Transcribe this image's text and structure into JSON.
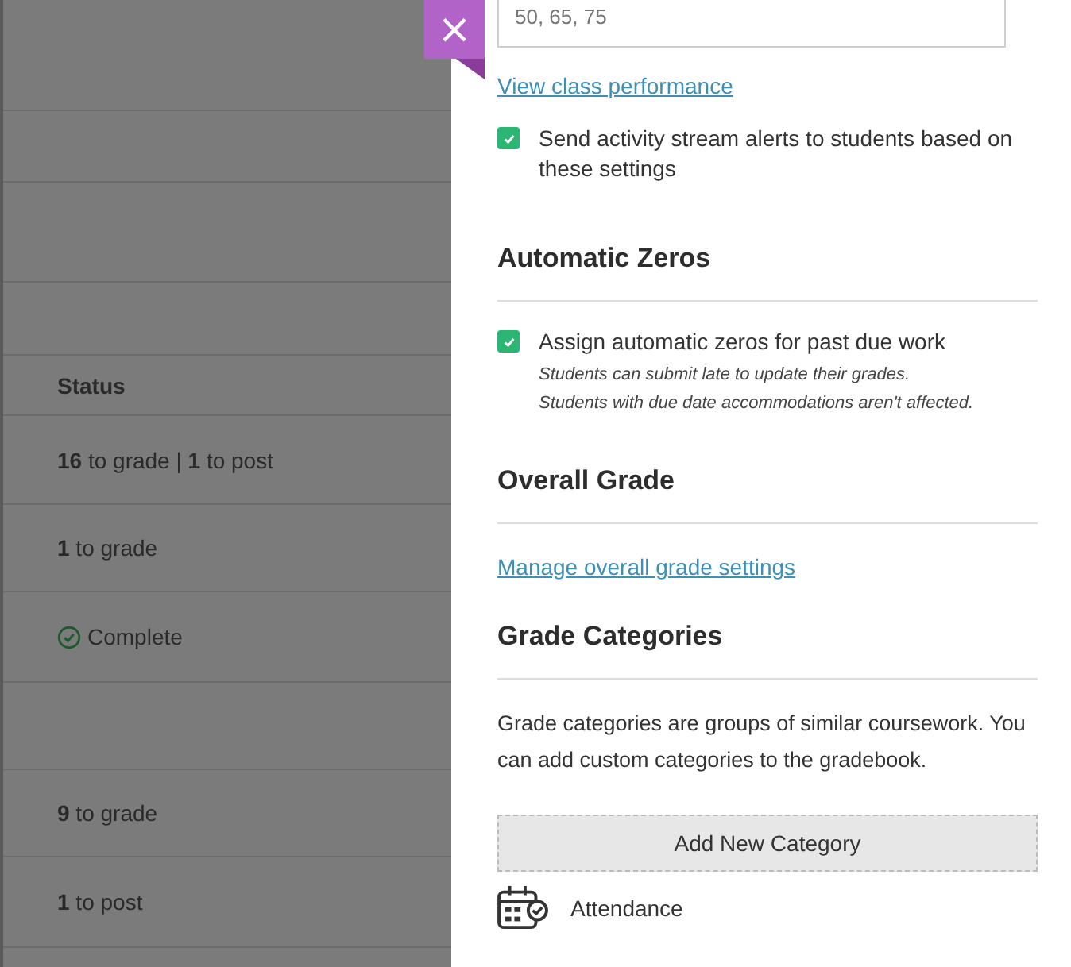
{
  "background_table": {
    "rows": [
      {
        "kind": "empty"
      },
      {
        "kind": "empty"
      },
      {
        "kind": "empty"
      },
      {
        "kind": "empty"
      },
      {
        "kind": "header",
        "text": "Status"
      },
      {
        "kind": "status",
        "text": "**16** to grade | **1** to post"
      },
      {
        "kind": "status",
        "text": "**1** to grade"
      },
      {
        "kind": "complete",
        "text": "Complete"
      },
      {
        "kind": "empty"
      },
      {
        "kind": "status",
        "text": "**9** to grade"
      },
      {
        "kind": "status",
        "text": "**1** to post"
      },
      {
        "kind": "empty"
      }
    ]
  },
  "close_button": {
    "label": "×"
  },
  "panel": {
    "input": {
      "value": "50, 65, 75"
    },
    "performance_link": "View class performance",
    "alerts": {
      "label": "Send activity stream alerts to students based on these settings",
      "checked": true
    },
    "automatic_zeros": {
      "heading": "Automatic Zeros",
      "label": "Assign automatic zeros for past due work",
      "checked": true,
      "notes": [
        "Students can submit late to update their grades.",
        "Students with due date accommodations aren't affected."
      ]
    },
    "overall_grade": {
      "heading": "Overall Grade",
      "link": "Manage overall grade settings"
    },
    "grade_categories": {
      "heading": "Grade Categories",
      "description": "Grade categories are groups of similar coursework. You can add custom categories to the gradebook.",
      "add_button": "Add New Category",
      "items": [
        {
          "label": "Attendance"
        }
      ]
    }
  }
}
